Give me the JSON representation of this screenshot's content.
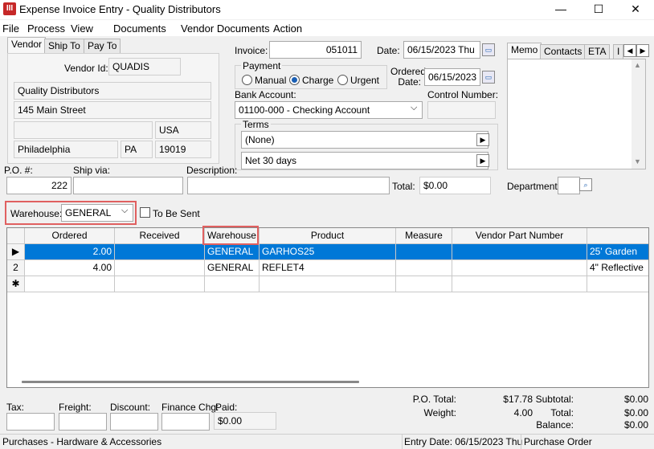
{
  "window": {
    "title": "Expense Invoice Entry - Quality Distributors",
    "app_icon": "III",
    "minimize": "—",
    "maximize": "☐",
    "close": "✕"
  },
  "menu": [
    "File",
    "Process",
    "View",
    "Documents",
    "Vendor Documents",
    "Action"
  ],
  "tabs": [
    "Vendor",
    "Ship To",
    "Pay To"
  ],
  "vendor": {
    "id_label": "Vendor Id:",
    "id": "QUADIS",
    "name": "Quality Distributors",
    "address1": "145 Main Street",
    "address2": "",
    "country": "USA",
    "city": "Philadelphia",
    "state": "PA",
    "zip": "19019"
  },
  "invoice": {
    "label": "Invoice:",
    "value": "051011",
    "date_label": "Date:",
    "date": "06/15/2023 Thu"
  },
  "payment": {
    "label": "Payment",
    "options": [
      "Manual",
      "Charge",
      "Urgent"
    ],
    "selected": "Charge"
  },
  "ordered": {
    "label_line1": "Ordered",
    "label_line2": "Date:",
    "date": "06/15/2023"
  },
  "bank": {
    "label": "Bank Account:",
    "value": "01100-000 - Checking Account"
  },
  "control": {
    "label": "Control Number:",
    "value": ""
  },
  "terms": {
    "label": "Terms",
    "line1": "(None)",
    "line2": "Net  30 days"
  },
  "right_tabs": [
    "Memo",
    "Contacts",
    "ETA",
    "I"
  ],
  "po": {
    "label": "P.O. #:",
    "value": "222",
    "shipvia_label": "Ship via:",
    "shipvia": "",
    "desc_label": "Description:",
    "desc": ""
  },
  "total": {
    "label": "Total:",
    "value": "$0.00"
  },
  "department": {
    "label": "Department:",
    "value": ""
  },
  "warehouse": {
    "label": "Warehouse:",
    "value": "GENERAL",
    "to_be_sent": "To Be Sent"
  },
  "grid": {
    "columns": [
      "Ordered",
      "Received",
      "Warehouse",
      "Product",
      "Measure",
      "Vendor Part Number",
      ""
    ],
    "rows": [
      {
        "marker": "▶",
        "ordered": "2.00",
        "received": "",
        "warehouse": "GENERAL",
        "product": "GARHOS25",
        "measure": "",
        "vpn": "",
        "desc": "25' Garden"
      },
      {
        "marker": "2",
        "ordered": "4.00",
        "received": "",
        "warehouse": "GENERAL",
        "product": "REFLET4",
        "measure": "",
        "vpn": "",
        "desc": "4\" Reflective"
      }
    ],
    "new_row_marker": "✱"
  },
  "footer": {
    "tax_label": "Tax:",
    "freight_label": "Freight:",
    "discount_label": "Discount:",
    "finance_label": "Finance Chg:",
    "paid_label": "Paid:",
    "paid": "$0.00",
    "po_total_label": "P.O. Total:",
    "po_total": "$17.78",
    "weight_label": "Weight:",
    "weight": "4.00",
    "subtotal_label": "Subtotal:",
    "subtotal": "$0.00",
    "total_label": "Total:",
    "total": "$0.00",
    "balance_label": "Balance:",
    "balance": "$0.00"
  },
  "status": {
    "left": "Purchases - Hardware & Accessories",
    "entry_date": "Entry Date: 06/15/2023 Thu",
    "mode": "Purchase Order"
  }
}
